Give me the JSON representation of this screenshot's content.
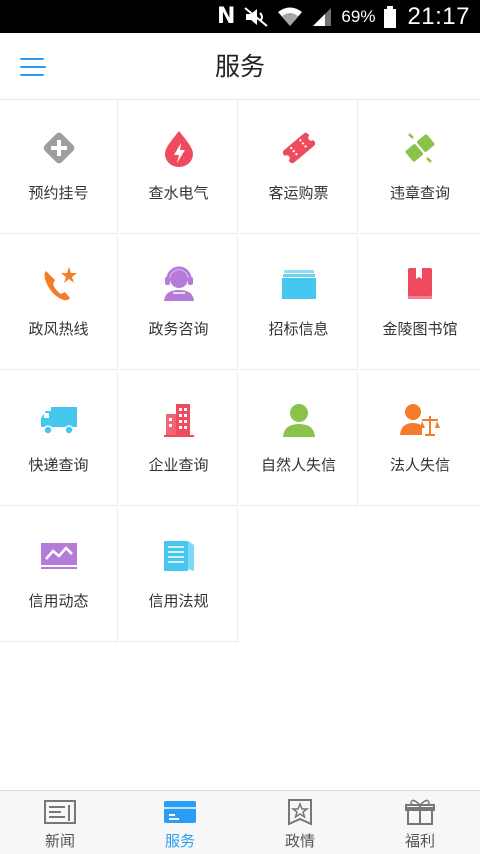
{
  "status_bar": {
    "battery_percent": "69%",
    "time": "21:17"
  },
  "header": {
    "title": "服务"
  },
  "colors": {
    "accent": "#2a9df4",
    "green": "#8bc34a",
    "red": "#f04a5f",
    "orange": "#f57c2a",
    "purple": "#b47bd8",
    "cyan": "#45c7f0",
    "gray": "#9e9e9e"
  },
  "services": [
    {
      "label": "预约挂号",
      "icon": "medical-plus-icon"
    },
    {
      "label": "查水电气",
      "icon": "utility-drop-icon"
    },
    {
      "label": "客运购票",
      "icon": "ticket-icon"
    },
    {
      "label": "违章查询",
      "icon": "traffic-violation-icon"
    },
    {
      "label": "政风热线",
      "icon": "hotline-phone-icon"
    },
    {
      "label": "政务咨询",
      "icon": "customer-service-icon"
    },
    {
      "label": "招标信息",
      "icon": "folder-icon"
    },
    {
      "label": "金陵图书馆",
      "icon": "book-icon"
    },
    {
      "label": "快递查询",
      "icon": "delivery-truck-icon"
    },
    {
      "label": "企业查询",
      "icon": "enterprise-building-icon"
    },
    {
      "label": "自然人失信",
      "icon": "person-icon"
    },
    {
      "label": "法人失信",
      "icon": "legal-person-scale-icon"
    },
    {
      "label": "信用动态",
      "icon": "trend-chart-icon"
    },
    {
      "label": "信用法规",
      "icon": "regulation-book-icon"
    }
  ],
  "tabs": [
    {
      "label": "新闻",
      "icon": "news-icon",
      "active": false
    },
    {
      "label": "服务",
      "icon": "service-card-icon",
      "active": true
    },
    {
      "label": "政情",
      "icon": "government-star-icon",
      "active": false
    },
    {
      "label": "福利",
      "icon": "gift-icon",
      "active": false
    }
  ]
}
